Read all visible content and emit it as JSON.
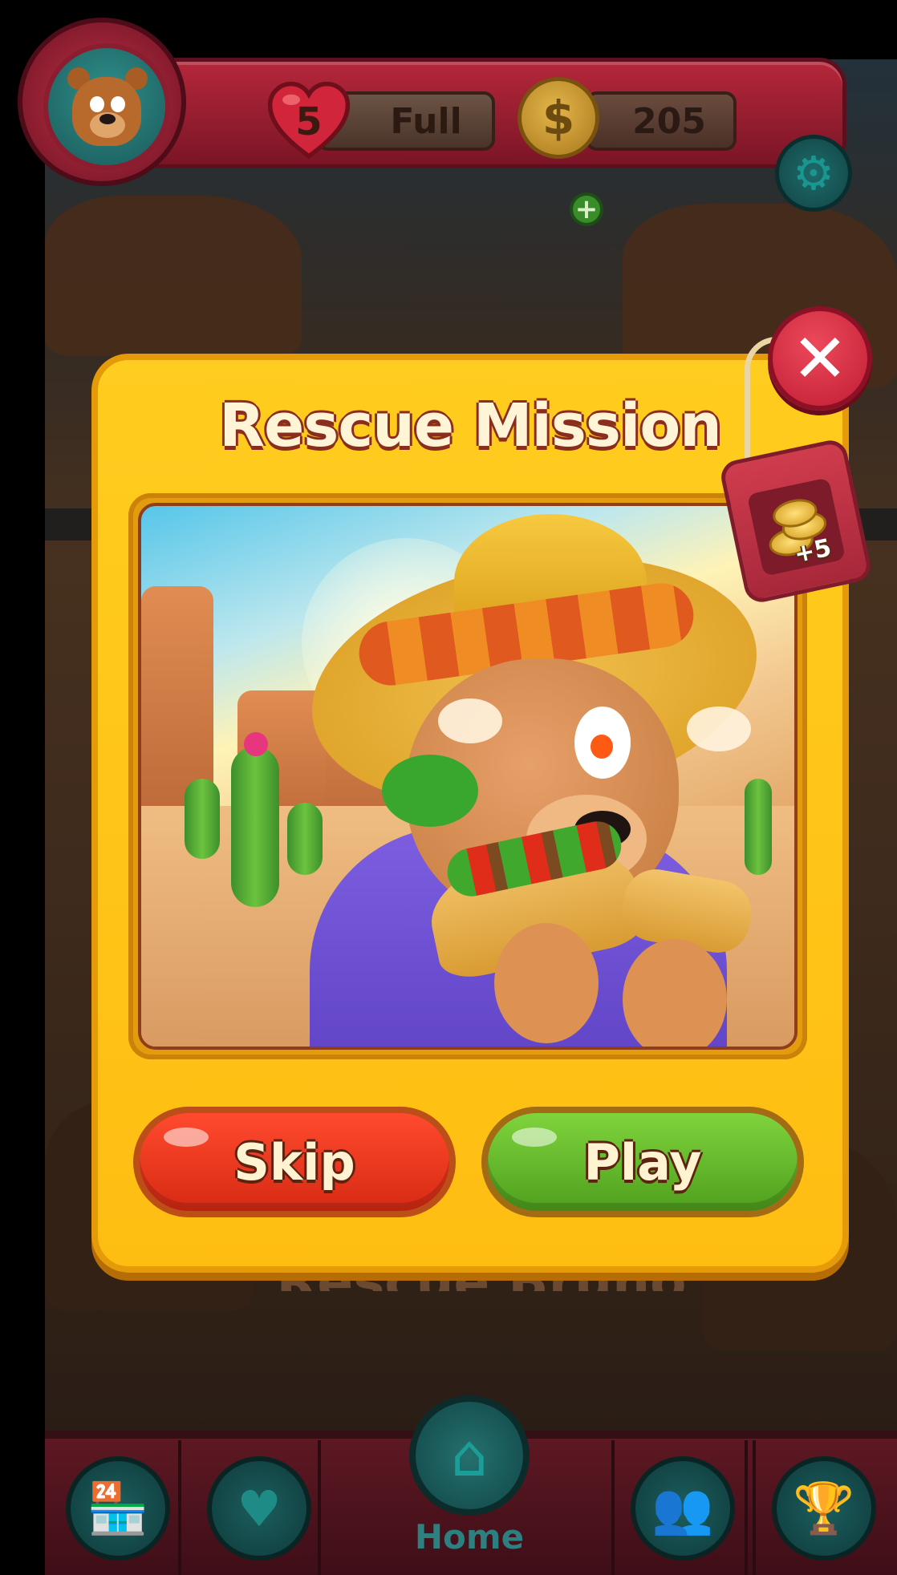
{
  "hud": {
    "lives_count": "5",
    "lives_status": "Full",
    "coins": "205"
  },
  "popup": {
    "title": "Rescue Mission",
    "reward_amount": "+5",
    "skip_label": "Skip",
    "play_label": "Play",
    "close_glyph": "✕"
  },
  "background": {
    "obscured_text": "Rescue Bruno"
  },
  "nav": {
    "home_label": "Home",
    "items": [
      {
        "icon": "shop-icon"
      },
      {
        "icon": "heart-icon"
      },
      {
        "icon": "home-icon"
      },
      {
        "icon": "team-icon"
      },
      {
        "icon": "trophy-icon"
      }
    ]
  },
  "colors": {
    "popup_yellow": "#ffc61a",
    "skip_red": "#e53520",
    "play_green": "#68bd2d",
    "hud_red": "#9d1f31",
    "nav_teal": "#1d5e5e"
  }
}
